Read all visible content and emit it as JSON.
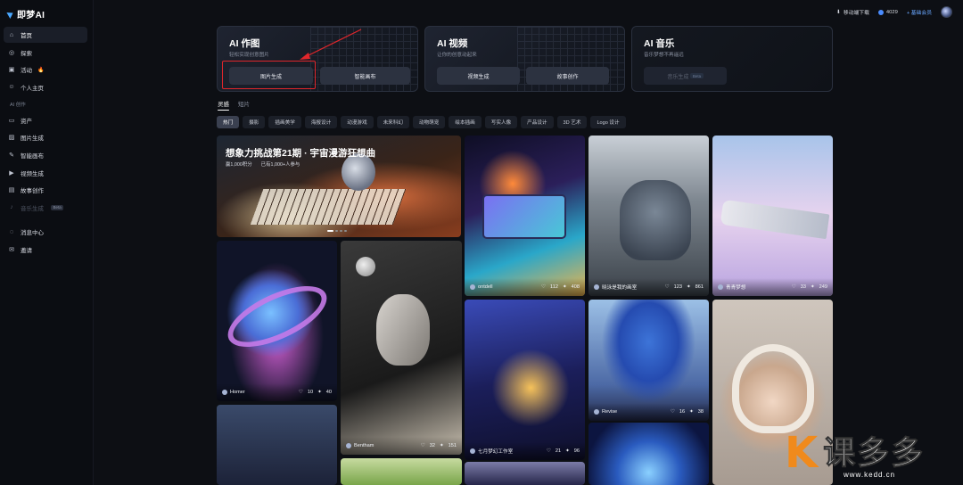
{
  "app": {
    "logo_text": "即梦AI"
  },
  "topbar": {
    "download_label": "移动端下载",
    "credits": "4029",
    "member_label": "+ 基础会员"
  },
  "sidebar": {
    "items": [
      {
        "label": "首页",
        "icon": "home-icon",
        "active": true
      },
      {
        "label": "探索",
        "icon": "compass-icon"
      },
      {
        "label": "活动",
        "icon": "calendar-icon",
        "flame": "🔥"
      },
      {
        "label": "个人主页",
        "icon": "user-icon"
      }
    ],
    "section_label": "AI 创作",
    "create_items": [
      {
        "label": "资产",
        "icon": "folder-icon"
      },
      {
        "label": "图片生成",
        "icon": "image-icon"
      },
      {
        "label": "智能画布",
        "icon": "canvas-icon"
      },
      {
        "label": "视频生成",
        "icon": "video-icon"
      },
      {
        "label": "故事创作",
        "icon": "book-icon"
      },
      {
        "label": "音乐生成",
        "icon": "music-icon",
        "badge": "Beta",
        "disabled": true
      }
    ],
    "bottom_items": [
      {
        "label": "消息中心",
        "icon": "bell-icon"
      },
      {
        "label": "邀请",
        "icon": "invite-icon"
      }
    ]
  },
  "cards": {
    "image": {
      "title": "AI 作图",
      "subtitle": "轻松实现创意图片",
      "btn1": "图片生成",
      "btn2": "智能画布"
    },
    "video": {
      "title": "AI 视频",
      "subtitle": "让你的创意动起来",
      "btn1": "视频生成",
      "btn2": "故事创作"
    },
    "music": {
      "title": "AI 音乐",
      "subtitle": "音乐梦想不再遥远",
      "btn1": "音乐生成",
      "badge": "Beta"
    }
  },
  "tabs": [
    "灵感",
    "短片"
  ],
  "chips": [
    "热门",
    "摄影",
    "插画美学",
    "海报设计",
    "动漫游戏",
    "未来科幻",
    "动物萌宠",
    "绘本插画",
    "写实人像",
    "产品设计",
    "3D 艺术",
    "Logo 设计"
  ],
  "hero": {
    "title": "想象力挑战第21期 · 宇宙漫游狂想曲",
    "sub1": "赢1,000积分",
    "sub2": "已有1,000+人参与"
  },
  "tiles": [
    {
      "id": "cassette",
      "user": "ontdell",
      "likes": "112",
      "remix": "408"
    },
    {
      "id": "cat",
      "user": "晓泳是我的画室",
      "likes": "123",
      "remix": "861"
    },
    {
      "id": "train",
      "user": "青青梦想",
      "likes": "33",
      "remix": "249"
    },
    {
      "id": "saturn",
      "user": "Homer",
      "likes": "10",
      "remix": "40"
    },
    {
      "id": "woman",
      "user": "Bentham",
      "likes": "32",
      "remix": "151"
    },
    {
      "id": "moto",
      "user": "七月梦幻工作室",
      "likes": "21",
      "remix": "96"
    },
    {
      "id": "tree",
      "user": "Revise",
      "likes": "16",
      "remix": "38"
    }
  ],
  "watermark": {
    "k": "K",
    "text": "课多多",
    "url": "www.kedd.cn"
  }
}
